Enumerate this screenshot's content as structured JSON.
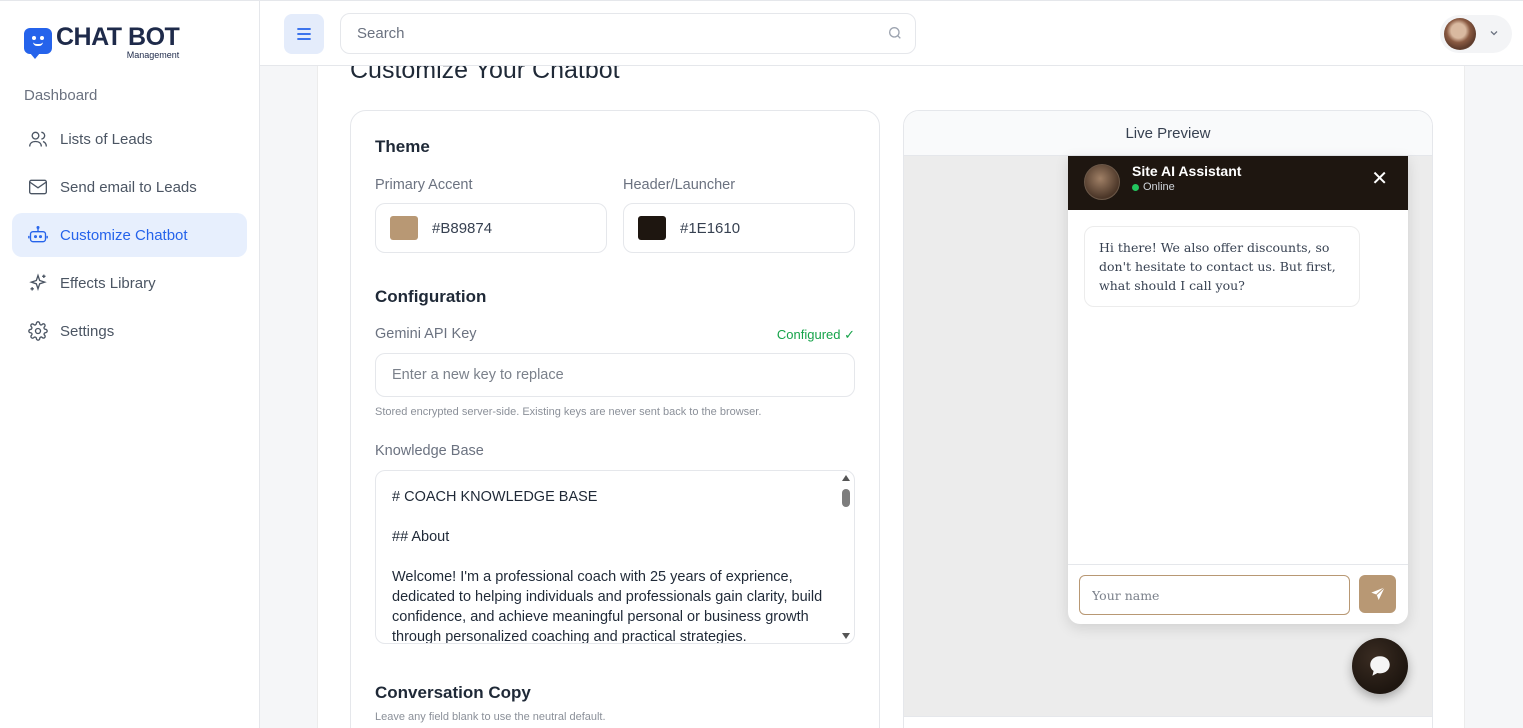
{
  "brand": {
    "title": "CHAT BOT",
    "subtitle": "Management"
  },
  "sidebar": {
    "section": "Dashboard",
    "items": [
      {
        "label": "Lists of Leads",
        "icon": "users-icon",
        "active": false
      },
      {
        "label": "Send email to Leads",
        "icon": "mail-icon",
        "active": false
      },
      {
        "label": "Customize Chatbot",
        "icon": "bot-icon",
        "active": true
      },
      {
        "label": "Effects Library",
        "icon": "sparkles-icon",
        "active": false
      },
      {
        "label": "Settings",
        "icon": "gear-icon",
        "active": false
      }
    ]
  },
  "topbar": {
    "search_placeholder": "Search"
  },
  "page": {
    "title": "Customize Your Chatbot"
  },
  "theme": {
    "title": "Theme",
    "primary_label": "Primary Accent",
    "primary_value": "#B89874",
    "header_label": "Header/Launcher",
    "header_value": "#1E1610"
  },
  "config": {
    "title": "Configuration",
    "api_label": "Gemini API Key",
    "api_status": "Configured ✓",
    "api_placeholder": "Enter a new key to replace",
    "api_hint": "Stored encrypted server-side. Existing keys are never sent back to the browser.",
    "kb_label": "Knowledge Base",
    "kb_text": "# COACH KNOWLEDGE BASE\n\n## About\n\nWelcome! I'm a professional coach with 25 years of exprience, dedicated to helping individuals and professionals gain clarity, build confidence, and achieve meaningful personal or business growth through personalized coaching and practical strategies."
  },
  "conversation": {
    "title": "Conversation Copy",
    "hint": "Leave any field blank to use the neutral default."
  },
  "preview": {
    "title": "Live Preview",
    "bot_name": "Site AI Assistant",
    "bot_status": "Online",
    "close": "✕",
    "greeting": "Hi there! We also offer discounts, so don't hesitate to contact us. But first, what should I call you?",
    "name_placeholder": "Your name"
  }
}
